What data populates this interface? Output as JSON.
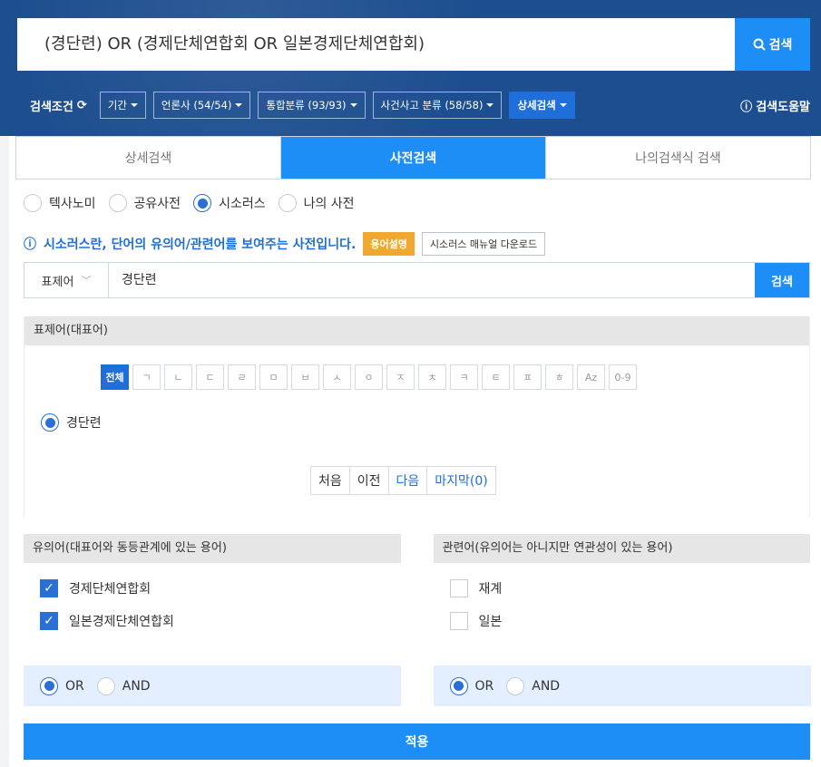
{
  "search": {
    "query": "(경단련) OR (경제단체연합회 OR 일본경제단체연합회)",
    "button": "검색"
  },
  "filters": {
    "label": "검색조건",
    "items": [
      "기간",
      "언론사 (54/54)",
      "통합분류 (93/93)",
      "사건사고 분류 (58/58)"
    ],
    "detail": "상세검색",
    "help": "검색도움말"
  },
  "tabs": [
    "상세검색",
    "사전검색",
    "나의검색식 검색"
  ],
  "dict_types": [
    "텍사노미",
    "공유사전",
    "시소러스",
    "나의 사전"
  ],
  "info": {
    "text": "시소러스란, 단어의 유의어/관련어를 보여주는 사전입니다.",
    "badge": "용어설명",
    "manual": "시소러스 매뉴얼 다운로드"
  },
  "term": {
    "select": "표제어",
    "value": "경단련",
    "button": "검색"
  },
  "rep": {
    "title": "표제어(대표어)",
    "alpha": [
      "전체",
      "ㄱ",
      "ㄴ",
      "ㄷ",
      "ㄹ",
      "ㅁ",
      "ㅂ",
      "ㅅ",
      "ㅇ",
      "ㅈ",
      "ㅊ",
      "ㅋ",
      "ㅌ",
      "ㅍ",
      "ㅎ",
      "Az",
      "0-9"
    ],
    "selected_term": "경단련",
    "pager": [
      "처음",
      "이전",
      "다음",
      "마지막(0)"
    ]
  },
  "synonyms": {
    "title": "유의어(대표어와 동등관계에 있는 용어)",
    "items": [
      "경제단체연합회",
      "일본경제단체연합회"
    ],
    "or": "OR",
    "and": "AND"
  },
  "related": {
    "title": "관련어(유의어는 아니지만 연관성이 있는 용어)",
    "items": [
      "재계",
      "일본"
    ],
    "or": "OR",
    "and": "AND"
  },
  "apply": "적용"
}
